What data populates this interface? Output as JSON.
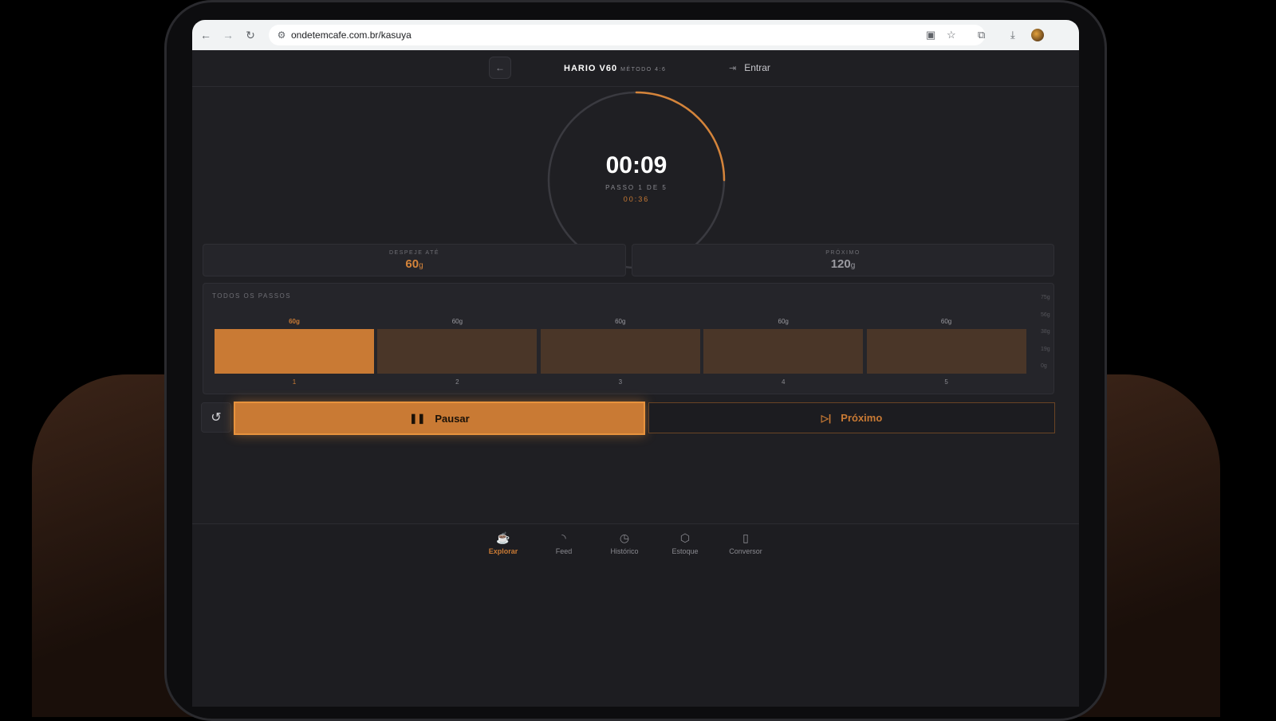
{
  "browser": {
    "url": "ondetemcafe.com.br/kasuya"
  },
  "header": {
    "title": "HARIO V60",
    "subtitle": "MÉTODO 4:6",
    "login_label": "Entrar"
  },
  "timer": {
    "elapsed": "00:09",
    "step_label": "PASSO 1 DE 5",
    "step_time": "00:36",
    "progress": 0.25
  },
  "pour": {
    "label": "DESPEJE ATÉ",
    "value": "60",
    "unit": "g"
  },
  "next_pour": {
    "label": "PRÓXIMO",
    "value": "120",
    "unit": "g"
  },
  "chart_data": {
    "type": "bar",
    "title": "TODOS OS PASSOS",
    "categories": [
      "1",
      "2",
      "3",
      "4",
      "5"
    ],
    "values": [
      60,
      60,
      60,
      60,
      60
    ],
    "value_labels": [
      "60g",
      "60g",
      "60g",
      "60g",
      "60g"
    ],
    "active_index": 0,
    "yticks": [
      "75g",
      "56g",
      "38g",
      "19g",
      "0g"
    ],
    "ylim": [
      0,
      75
    ],
    "colors": {
      "active": "#c97a34",
      "inactive": "#4a3628"
    }
  },
  "controls": {
    "pause_label": "Pausar",
    "next_label": "Próximo"
  },
  "nav": {
    "items": [
      {
        "label": "Explorar",
        "icon": "coffee-cup-icon",
        "active": true
      },
      {
        "label": "Feed",
        "icon": "rss-icon",
        "active": false
      },
      {
        "label": "Histórico",
        "icon": "clock-icon",
        "active": false
      },
      {
        "label": "Estoque",
        "icon": "box-icon",
        "active": false
      },
      {
        "label": "Conversor",
        "icon": "grinder-icon",
        "active": false
      }
    ]
  },
  "colors": {
    "accent": "#c97a34",
    "background": "#1f1f23",
    "panel": "#25252a"
  }
}
